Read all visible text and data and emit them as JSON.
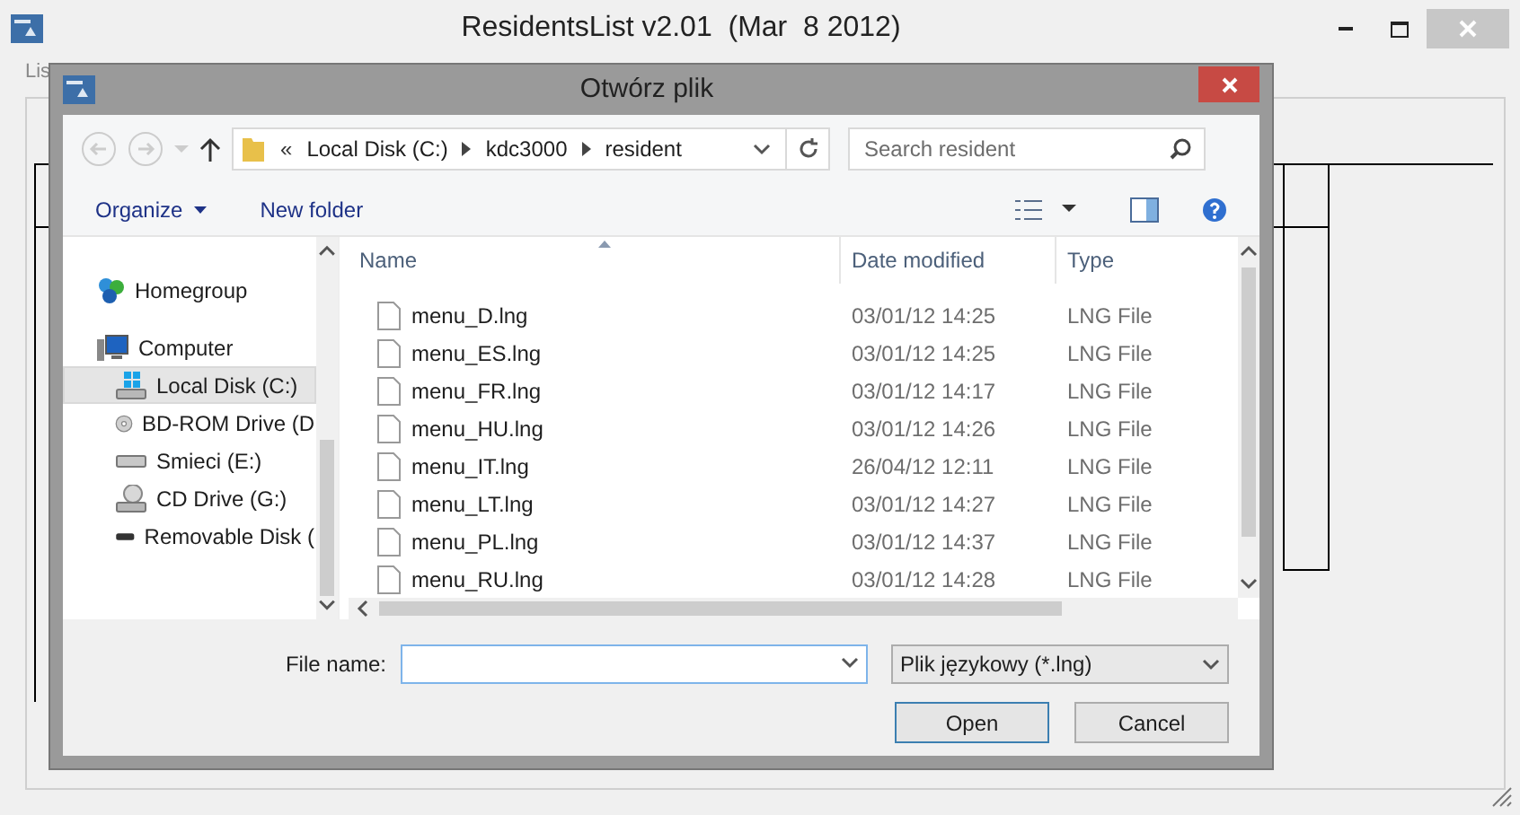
{
  "app": {
    "title": "ResidentsList v2.01  (Mar  8 2012)",
    "menu": [
      "Lis"
    ]
  },
  "dialog": {
    "title": "Otwórz plik",
    "address": {
      "prefix": "«",
      "parts": [
        "Local Disk (C:)",
        "kdc3000",
        "resident"
      ]
    },
    "search": {
      "placeholder": "Search resident"
    },
    "toolbar": [
      "Organize",
      "New folder"
    ],
    "nav": [
      {
        "label": "Homegroup",
        "kind": "homegroup",
        "selected": false
      },
      {
        "label": "Computer",
        "kind": "computer",
        "selected": false,
        "children": [
          {
            "label": "Local Disk (C:)",
            "kind": "system-disk",
            "selected": true
          },
          {
            "label": "BD-ROM Drive (D",
            "kind": "optical",
            "selected": false
          },
          {
            "label": "Smieci (E:)",
            "kind": "disk",
            "selected": false
          },
          {
            "label": "CD Drive (G:)",
            "kind": "cd",
            "selected": false
          },
          {
            "label": "Removable Disk (",
            "kind": "removable",
            "selected": false
          }
        ]
      }
    ],
    "columns": [
      "Name",
      "Date modified",
      "Type"
    ],
    "files": [
      {
        "name": "menu_D.lng",
        "date": "03/01/12 14:25",
        "type": "LNG File"
      },
      {
        "name": "menu_ES.lng",
        "date": "03/01/12 14:25",
        "type": "LNG File"
      },
      {
        "name": "menu_FR.lng",
        "date": "03/01/12 14:17",
        "type": "LNG File"
      },
      {
        "name": "menu_HU.lng",
        "date": "03/01/12 14:26",
        "type": "LNG File"
      },
      {
        "name": "menu_IT.lng",
        "date": "26/04/12 12:11",
        "type": "LNG File"
      },
      {
        "name": "menu_LT.lng",
        "date": "03/01/12 14:27",
        "type": "LNG File"
      },
      {
        "name": "menu_PL.lng",
        "date": "03/01/12 14:37",
        "type": "LNG File"
      },
      {
        "name": "menu_RU.lng",
        "date": "03/01/12 14:28",
        "type": "LNG File"
      }
    ],
    "file_name": {
      "label": "File name:"
    },
    "filter": "Plik językowy (*.lng)",
    "buttons": [
      "Open",
      "Cancel"
    ]
  }
}
